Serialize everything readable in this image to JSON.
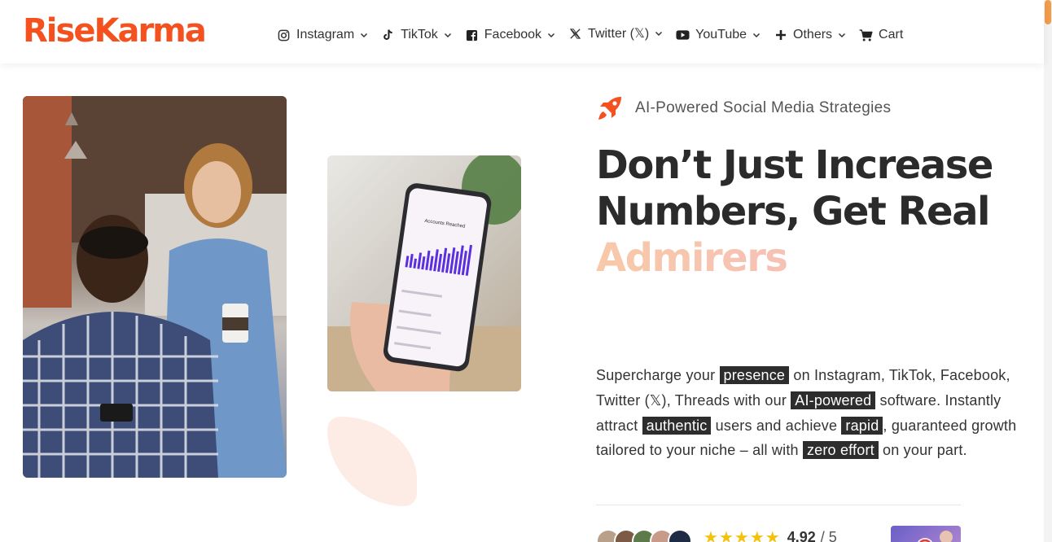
{
  "brand": {
    "logo_text": "RiseKarma",
    "color": "#f4511e"
  },
  "nav": {
    "items": [
      {
        "label": "Instagram",
        "icon": "instagram-icon",
        "has_dropdown": true
      },
      {
        "label": "TikTok",
        "icon": "tiktok-icon",
        "has_dropdown": true
      },
      {
        "label": "Facebook",
        "icon": "facebook-icon",
        "has_dropdown": true
      },
      {
        "label": "Twitter (𝕏)",
        "icon": "x-twitter-icon",
        "has_dropdown": true
      },
      {
        "label": "YouTube",
        "icon": "youtube-icon",
        "has_dropdown": true
      },
      {
        "label": "Others",
        "icon": "plus-icon",
        "has_dropdown": true
      },
      {
        "label": "Cart",
        "icon": "cart-icon",
        "has_dropdown": false
      }
    ]
  },
  "hero": {
    "tagline": "AI-Powered Social Media Strategies",
    "tagline_icon": "rocket-icon",
    "headline_line1": "Don’t Just Increase",
    "headline_line2": "Numbers, Get Real",
    "headline_accent": "Admirers",
    "description": {
      "t1": "Supercharge your ",
      "h1": "presence",
      "t2": " on Instagram, TikTok, Facebook, Twitter (𝕏), Threads with our ",
      "h2": "AI-powered",
      "t3": " software. Instantly attract ",
      "h3": "authentic",
      "t4": " users and achieve ",
      "h4": "rapid",
      "t5": ", guaranteed growth tailored to your niche – all with ",
      "h5": "zero effort",
      "t6": " on your part."
    }
  },
  "rating": {
    "stars": 5,
    "value": "4.92",
    "max": "/ 5"
  },
  "colors": {
    "accent": "#f4511e",
    "highlight_bg": "#2d2d2d",
    "star": "#f4c20d",
    "blob": "#fdece6"
  }
}
